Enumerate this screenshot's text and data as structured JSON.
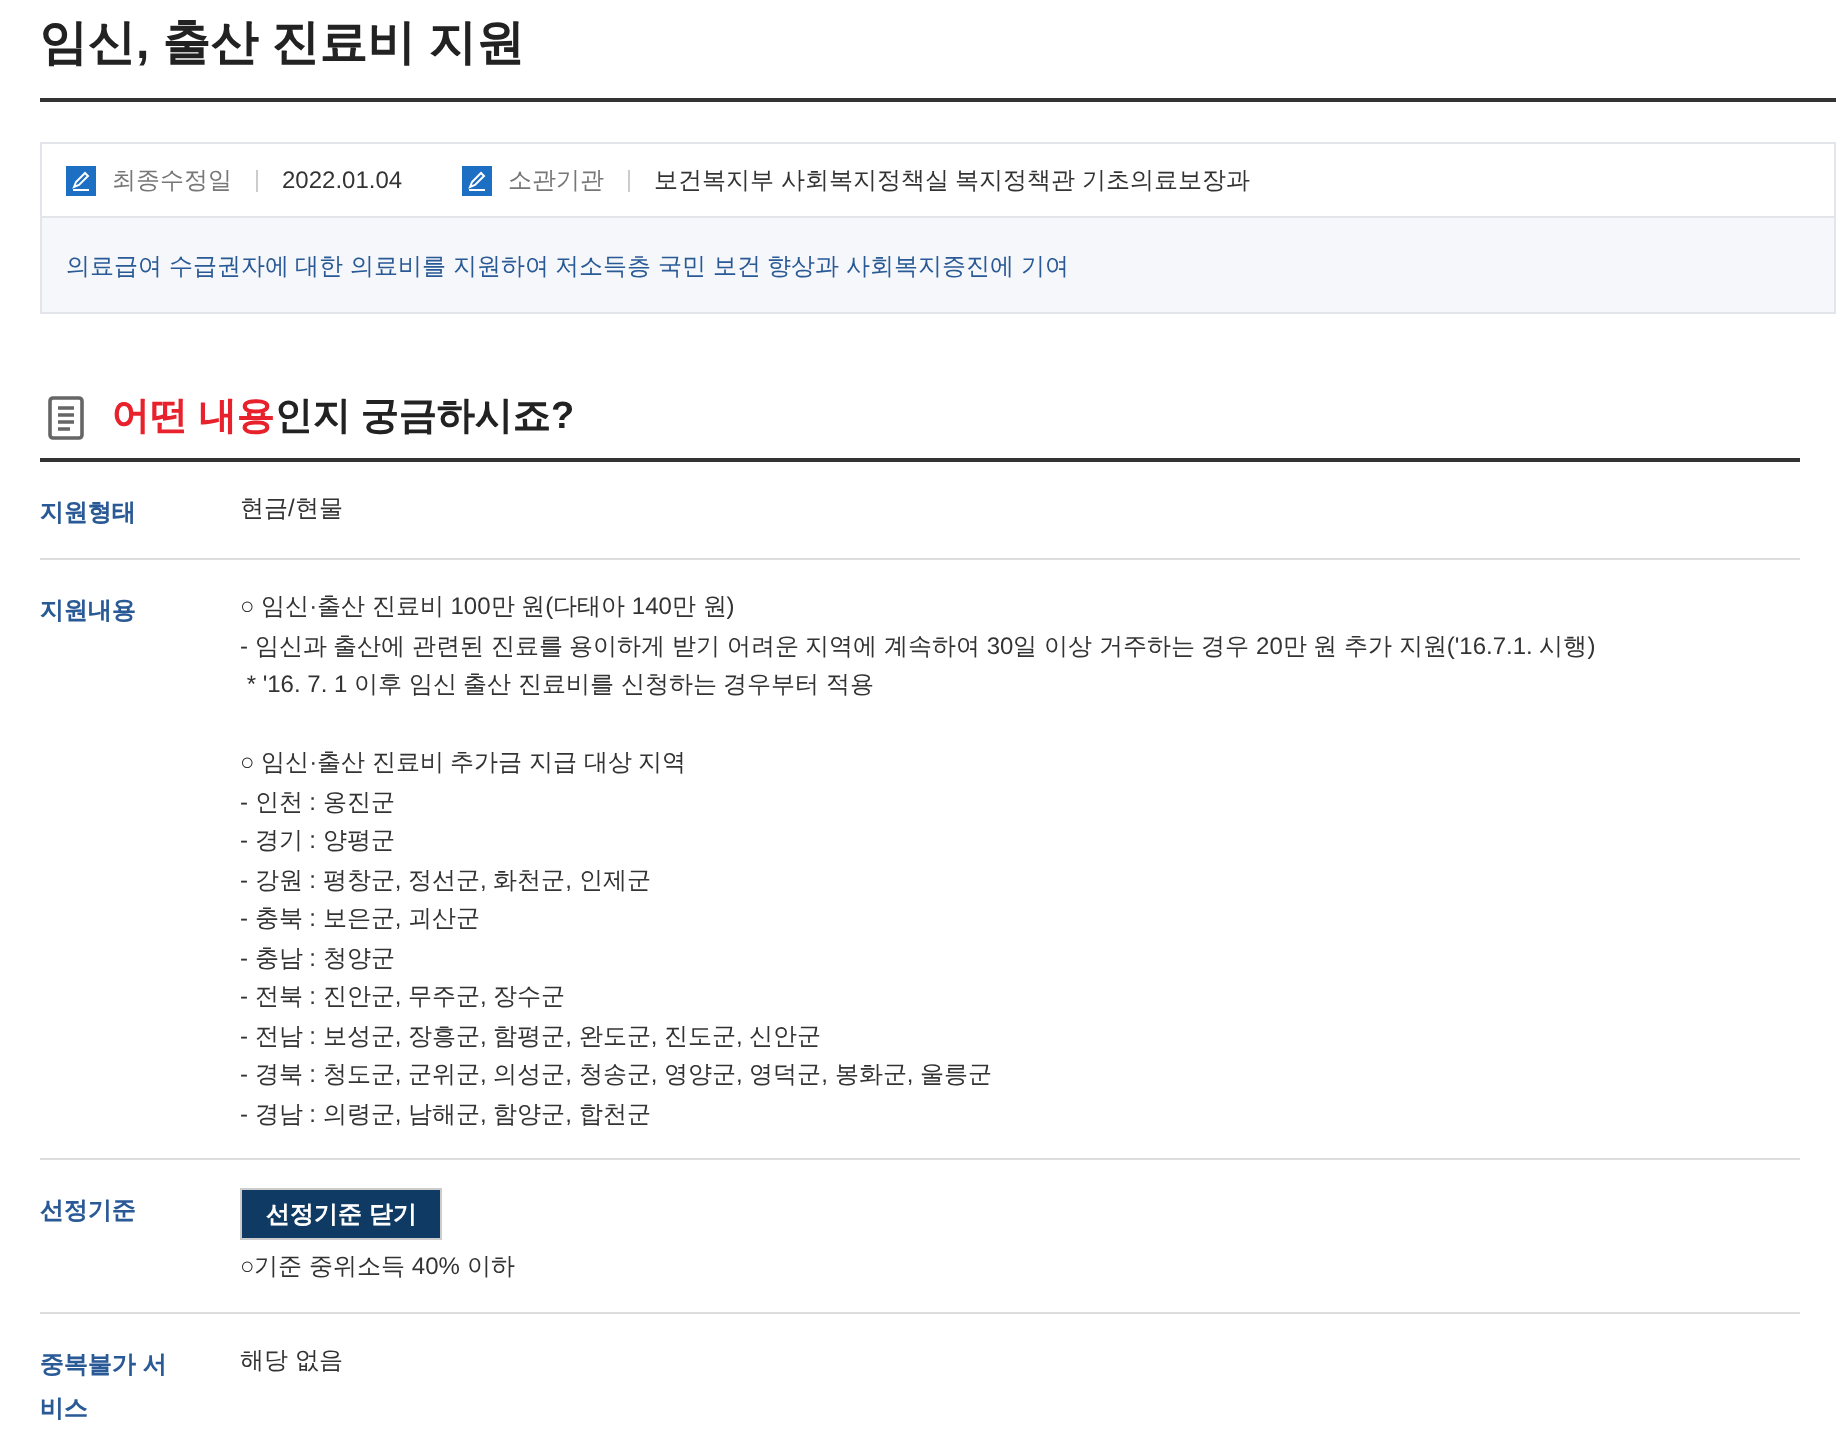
{
  "title": "임신, 출산 진료비 지원",
  "info": {
    "fields": [
      {
        "label": "최종수정일",
        "value": "2022.01.04"
      },
      {
        "label": "소관기관",
        "value": "보건복지부 사회복지정책실 복지정책관 기초의료보장과"
      }
    ],
    "description": "의료급여 수급권자에 대한 의료비를 지원하여 저소득층 국민 보건 향상과 사회복지증진에 기여"
  },
  "section": {
    "highlight": "어떤 내용",
    "rest": "인지 궁금하시죠?"
  },
  "rows": [
    {
      "label": "지원형태",
      "paragraphs": [
        [
          "현금/현물"
        ]
      ]
    },
    {
      "label": "지원내용",
      "paragraphs": [
        [
          "○ 임신·출산 진료비 100만 원(다태아 140만 원)",
          "- 임신과 출산에 관련된 진료를 용이하게 받기 어려운 지역에 계속하여 30일 이상 거주하는 경우 20만 원 추가 지원('16.7.1. 시행)",
          " * '16. 7. 1 이후 임신 출산 진료비를 신청하는 경우부터 적용"
        ],
        [
          "○ 임신·출산 진료비 추가금 지급 대상 지역",
          "- 인천 : 옹진군",
          "- 경기 : 양평군",
          "- 강원 : 평창군, 정선군, 화천군, 인제군",
          "- 충북 : 보은군, 괴산군",
          "- 충남 : 청양군",
          "- 전북 : 진안군, 무주군, 장수군",
          "- 전남 : 보성군, 장흥군, 함평군, 완도군, 진도군, 신안군",
          "- 경북 : 청도군, 군위군, 의성군, 청송군, 영양군, 영덕군, 봉화군, 울릉군",
          "- 경남 : 의령군, 남해군, 함양군, 합천군"
        ]
      ]
    },
    {
      "label": "선정기준",
      "button": "선정기준 닫기",
      "paragraphs": [
        [
          "○기준 중위소득 40% 이하"
        ]
      ]
    },
    {
      "label": "중복불가 서비스",
      "paragraphs": [
        [
          "해당 없음"
        ]
      ]
    }
  ]
}
